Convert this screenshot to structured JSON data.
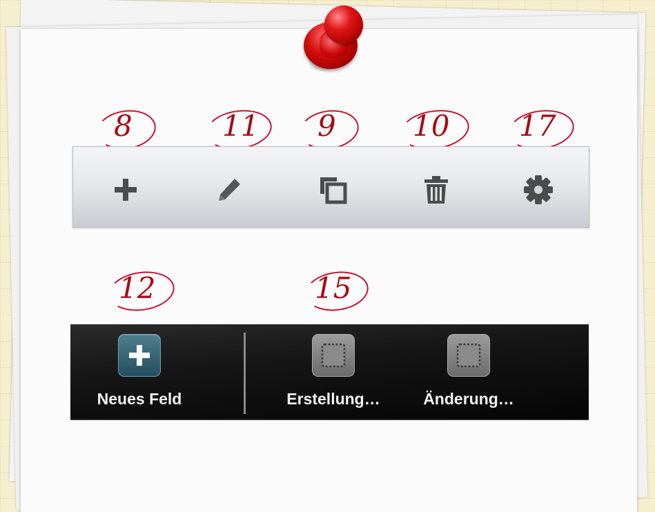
{
  "annotations": {
    "add": "8",
    "edit": "11",
    "duplicate": "9",
    "delete": "10",
    "settings": "17",
    "new_field": "12",
    "created_field": "15"
  },
  "toolbar_light": {
    "buttons": [
      {
        "name": "add-button",
        "icon": "plus-icon"
      },
      {
        "name": "edit-button",
        "icon": "pencil-icon"
      },
      {
        "name": "duplicate-button",
        "icon": "duplicate-icon"
      },
      {
        "name": "delete-button",
        "icon": "trash-icon"
      },
      {
        "name": "settings-button",
        "icon": "gear-icon"
      }
    ],
    "icon_color": "#4c4c4c"
  },
  "toolbar_dark": {
    "items": [
      {
        "label": "Neues Feld",
        "icon": "plus-tile-icon"
      },
      {
        "label": "Erstellung…",
        "icon": "field-tile-icon"
      },
      {
        "label": "Änderung…",
        "icon": "field-tile-icon"
      }
    ]
  },
  "colors": {
    "annotation_red": "#c8102e",
    "background_paper": "#f6efcf"
  }
}
